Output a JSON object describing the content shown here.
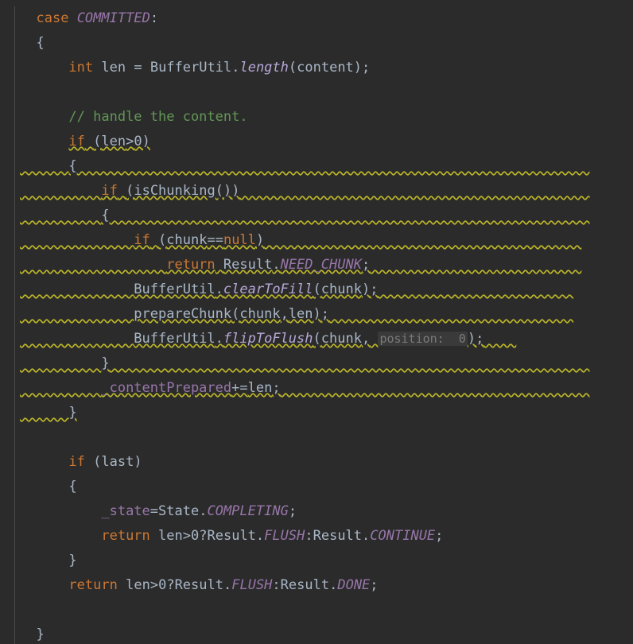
{
  "kw": {
    "case": "case",
    "int": "int",
    "if": "if",
    "return": "return",
    "null": "null"
  },
  "const": {
    "committed": "COMMITTED",
    "need_chunk": "NEED_CHUNK",
    "completing": "COMPLETING",
    "flush": "FLUSH",
    "continue": "CONTINUE",
    "done": "DONE"
  },
  "id": {
    "len": "len",
    "BufferUtil": "BufferUtil",
    "length": "length",
    "content": "content",
    "isChunking": "isChunking",
    "chunk": "chunk",
    "Result": "Result",
    "clearToFill": "clearToFill",
    "prepareChunk": "prepareChunk",
    "flipToFlush": "flipToFlush",
    "contentPrepared": "_contentPrepared",
    "last": "last",
    "state": "_state",
    "State": "State"
  },
  "comment": {
    "handle": "// handle the content."
  },
  "hint": {
    "position0": "position: "
  },
  "num": {
    "zero": "0"
  },
  "sym": {
    "lbrace": "{",
    "rbrace": "}",
    "lparen": "(",
    "rparen": ")",
    "colon": ":",
    "semi": ";",
    "eq": "=",
    "eqeq": "==",
    "pluseq": "+=",
    "gt": ">",
    "dot": ".",
    "comma": ",",
    "q": "?"
  }
}
